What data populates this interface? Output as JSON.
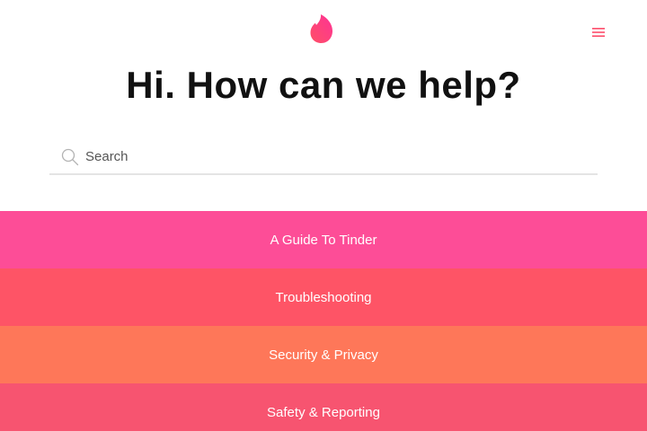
{
  "header": {
    "logo_icon": "flame-icon",
    "menu_icon": "hamburger-menu-icon"
  },
  "hero": {
    "title": "Hi. How can we help?"
  },
  "search": {
    "icon": "search-icon",
    "placeholder": "Search",
    "value": ""
  },
  "categories": [
    {
      "label": "A Guide To Tinder",
      "color": "#fd4d97"
    },
    {
      "label": "Troubleshooting",
      "color": "#fe5466"
    },
    {
      "label": "Security & Privacy",
      "color": "#fe7759"
    },
    {
      "label": "Safety & Reporting",
      "color": "#f75470"
    }
  ],
  "colors": {
    "brand_gradient_start": "#fd5067",
    "brand_gradient_end": "#ff2d8f",
    "menu_icon": "#fd4d6a"
  }
}
